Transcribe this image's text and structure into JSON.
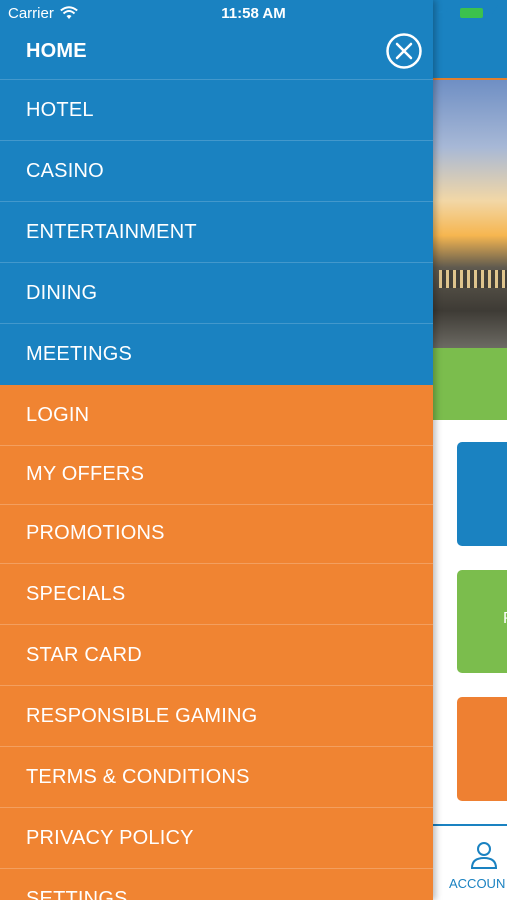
{
  "status_bar": {
    "carrier": "Carrier",
    "time": "11:58 AM",
    "icons": [
      "wifi-icon",
      "location-icon",
      "battery-icon",
      "charging-bolt-icon"
    ]
  },
  "menu": {
    "primary": [
      {
        "label": "HOME",
        "active": true
      },
      {
        "label": "HOTEL"
      },
      {
        "label": "CASINO"
      },
      {
        "label": "ENTERTAINMENT"
      },
      {
        "label": "DINING"
      },
      {
        "label": "MEETINGS"
      }
    ],
    "secondary": [
      {
        "label": "LOGIN"
      },
      {
        "label": "MY OFFERS"
      },
      {
        "label": "PROMOTIONS"
      },
      {
        "label": "SPECIALS"
      },
      {
        "label": "STAR CARD"
      },
      {
        "label": "RESPONSIBLE GAMING"
      },
      {
        "label": "TERMS & CONDITIONS"
      },
      {
        "label": "PRIVACY POLICY"
      },
      {
        "label": "SETTINGS"
      }
    ],
    "close_icon": "close-circle-icon"
  },
  "background_app": {
    "tile_letter": "P",
    "tab_label": "ACCOUN",
    "tab_icon": "account-person-icon"
  },
  "colors": {
    "primary_blue": "#1a82c1",
    "accent_orange": "#f08432",
    "accent_green": "#7bbd4d"
  }
}
